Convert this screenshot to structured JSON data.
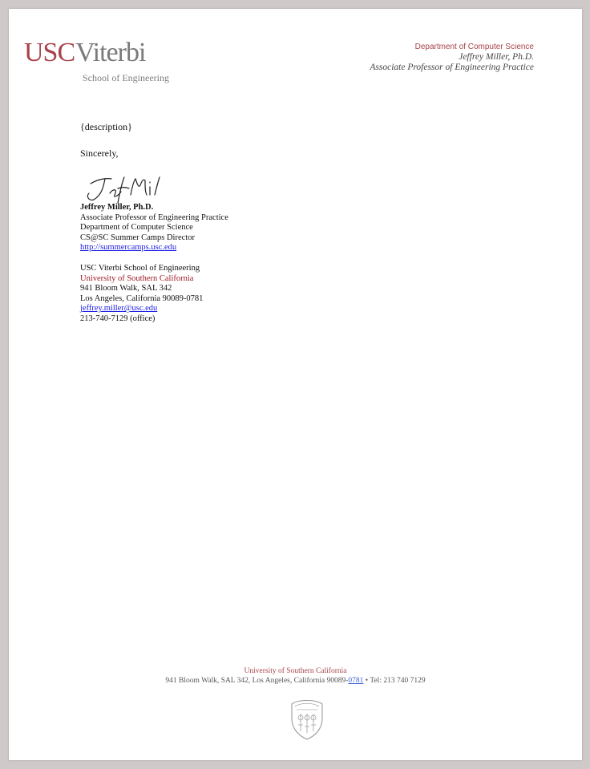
{
  "letterhead": {
    "logo_usc": "USC",
    "logo_viterbi": "Viterbi",
    "logo_sub": "School of Engineering",
    "department": "Department of Computer Science",
    "author": "Jeffrey Miller, Ph.D.",
    "author_title": "Associate Professor of Engineering Practice"
  },
  "letter": {
    "body": "{description}",
    "closing": "Sincerely,"
  },
  "signature_block": {
    "name": "Jeffrey Miller, Ph.D.",
    "title": "Associate Professor of Engineering Practice",
    "department": "Department of Computer Science",
    "role": "CS@SC Summer Camps Director",
    "website": "http://summercamps.usc.edu",
    "school": "USC Viterbi School of Engineering",
    "university": "University of Southern California",
    "street": "941 Bloom Walk, SAL 342",
    "city": "Los Angeles, California 90089-0781",
    "email": "jeffrey.miller@usc.edu",
    "phone": "213-740-7129 (office)"
  },
  "footer": {
    "university": "University of Southern California",
    "address_prefix": "941 Bloom Walk, SAL 342, Los Angeles, California 90089-",
    "zip_suffix": "0781",
    "separator": " • ",
    "tel": "Tel: 213 740 7129"
  },
  "colors": {
    "usc_cardinal": "#a9434a",
    "link_blue": "#1a1ae6",
    "page_bg": "#ffffff",
    "frame_bg": "#cfc9c9"
  }
}
